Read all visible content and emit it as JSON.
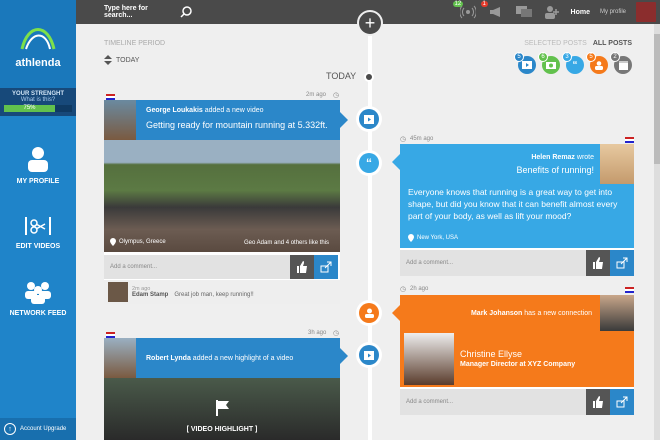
{
  "sidebar": {
    "logo_text": "athlenda",
    "strength_title": "YOUR STRENGHT",
    "strength_link": "What is this?",
    "strength_value": "75%",
    "strength_fraction": 0.75,
    "nav": [
      {
        "label": "MY PROFILE",
        "icon": "person-icon"
      },
      {
        "label": "EDIT VIDEOS",
        "icon": "scissors-icon"
      },
      {
        "label": "NETWORK FEED",
        "icon": "group-icon"
      }
    ],
    "upgrade_label": "Account Upgrade"
  },
  "topbar": {
    "search_placeholder": "Type here for search...",
    "badges": {
      "signal": "12",
      "alert": "1"
    },
    "home": "Home",
    "my_profile": "My profile"
  },
  "timeline": {
    "period_label": "TIMELINE PERIOD",
    "period_value": "TODAY",
    "today_label": "TODAY",
    "filter_selected": "SELECTED POSTS",
    "filter_all": "ALL POSTS",
    "filter_icons": [
      {
        "icon": "video-icon",
        "count": "5",
        "color": "#2b87c9"
      },
      {
        "icon": "camera-icon",
        "count": "6",
        "color": "#62c14d"
      },
      {
        "icon": "quote-icon",
        "count": "3",
        "color": "#37a8e5"
      },
      {
        "icon": "person-icon",
        "count": "5",
        "color": "#f57a1b"
      },
      {
        "icon": "calendar-icon",
        "count": "2",
        "color": "#777777"
      }
    ]
  },
  "posts": {
    "p1": {
      "time": "2m ago",
      "author": "George Loukakis",
      "action": " added a new video",
      "title": "Getting ready for mountain running at 5.332ft.",
      "location": "Olympus, Greece",
      "likes": "Geo Adam and 4 others like this",
      "comment_placeholder": "Add a comment...",
      "commenter_time": "2m ago",
      "commenter": "Edam Stamp",
      "comment": "Great job man, keep running!!"
    },
    "p2": {
      "time": "45m ago",
      "author": "Helen Remaz",
      "action": " wrote",
      "title": "Benefits of running!",
      "body": "Everyone knows that running is a great way to get into shape, but did you know that it can benefit almost every part of your body, as well as lift your mood?",
      "location": "New York, USA",
      "comment_placeholder": "Add a comment..."
    },
    "p3": {
      "time": "2h ago",
      "author": "Mark Johanson",
      "action": " has a new connection",
      "connection_name": "Christine Ellyse",
      "connection_title": "Manager Director at XYZ Company",
      "comment_placeholder": "Add a comment..."
    },
    "p4": {
      "time": "3h ago",
      "author": "Robert Lynda",
      "action": " added a new highlight of a video",
      "highlight_label": "[ VIDEO HIGHLIGHT ]"
    }
  }
}
